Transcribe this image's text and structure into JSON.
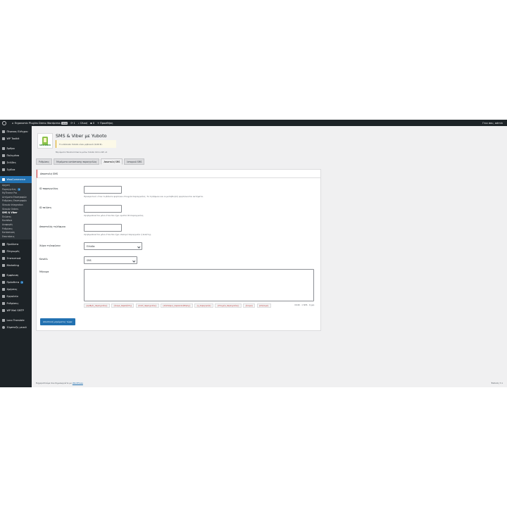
{
  "adminbar": {
    "site_name": "Ergonomic Plugins Demo Wordpress",
    "site_badge": "Live",
    "updates": "1",
    "search": "Ολική",
    "comments": "0",
    "new": "Προσθήκη",
    "user": "Γεια σου, admin"
  },
  "sidebar": {
    "top_items": [
      {
        "label": "Πίνακας Ελέγχου",
        "icon": "dashboard-icon"
      },
      {
        "label": "WP Toolkit",
        "icon": "toolkit-icon"
      }
    ],
    "content_items": [
      {
        "label": "Άρθρα",
        "icon": "pin-icon"
      },
      {
        "label": "Πολυμέσα",
        "icon": "media-icon"
      },
      {
        "label": "Σελίδες",
        "icon": "pages-icon"
      },
      {
        "label": "Σχόλια",
        "icon": "comments-icon"
      }
    ],
    "woocommerce": {
      "label": "WooCommerce",
      "icon": "woocommerce-icon"
    },
    "woo_sub": [
      {
        "label": "Αρχική",
        "current": false
      },
      {
        "label": "Παραγγελίες",
        "count": "1",
        "current": false
      },
      {
        "label": "MyTheme Pro",
        "current": false
      },
      {
        "label": "Αιτήματα Επιστροφών",
        "current": false
      },
      {
        "label": "Ρυθμίσεις Επιστροφών",
        "current": false
      },
      {
        "label": "Skroutz Integration",
        "current": false
      },
      {
        "label": "Skroutz Orders",
        "current": false
      },
      {
        "label": "SMS & Viber",
        "current": true
      },
      {
        "label": "Πελάτες",
        "current": false
      },
      {
        "label": "Κουπόνια",
        "current": false
      },
      {
        "label": "Αναφορές",
        "current": false
      },
      {
        "label": "Ρυθμίσεις",
        "current": false
      },
      {
        "label": "Κατάσταση",
        "current": false
      },
      {
        "label": "Επεκτάσεις",
        "current": false
      }
    ],
    "bottom_group_1": [
      {
        "label": "Προϊόντα",
        "icon": "products-icon"
      },
      {
        "label": "Πληρωμές",
        "icon": "payments-icon"
      },
      {
        "label": "Στατιστικά",
        "icon": "analytics-icon"
      },
      {
        "label": "Marketing",
        "icon": "marketing-icon"
      }
    ],
    "bottom_group_2": [
      {
        "label": "Εμφάνιση",
        "icon": "appearance-icon"
      },
      {
        "label": "Πρόσθετα",
        "icon": "plugins-icon",
        "count": "1"
      },
      {
        "label": "Χρήστες",
        "icon": "users-icon"
      },
      {
        "label": "Εργαλεία",
        "icon": "tools-icon"
      },
      {
        "label": "Ρυθμίσεις",
        "icon": "settings-icon"
      },
      {
        "label": "WP Mail SMTP",
        "icon": "mail-icon"
      }
    ],
    "bottom_group_3": [
      {
        "label": "Loco Translate",
        "icon": "translate-icon"
      },
      {
        "label": "Σύμπτυξη μενού",
        "icon": "collapse-icon"
      }
    ]
  },
  "page": {
    "title": "SMS & Viber με Yuboto",
    "logo_text": "SMS-VIBER",
    "notice": "Το υπόλοιπο Yuboto είναι μηδενικό (0,00 €).",
    "subtitle": "Μηνύματα WooCommerce μέσω Yuboto Omni API v1"
  },
  "tabs": [
    {
      "label": "Ρυθμίσεις",
      "active": false
    },
    {
      "label": "Μηνύματα κατάστασης παραγγελίας",
      "active": false
    },
    {
      "label": "Αποστολή SMS",
      "active": true
    },
    {
      "label": "Ιστορικό SMS",
      "active": false
    }
  ],
  "form": {
    "panel_title": "Αποστολή SMS",
    "order_id_label": "ID παραγγελίας",
    "order_id_help": "Προαιρετικό: όταν το βάλετε φορτώνει στοιχεία παραγγελίας. Το τηλέφωνο και οι μεταβλητές φορτώνονται αυτόματα.",
    "client_id_label": "ID πελάτη",
    "client_id_help": "Χρησιμοποιείται μόνο όταν δεν έχει οριστεί ID παραγγελίας.",
    "phone_label": "Αποστολής τηλέφωνο",
    "phone_help": "Χρησιμοποιείται μόνο όταν δεν έχει επιλεγεί παραγγελία ή πελάτης.",
    "country_label": "Χώρα τηλεφώνου",
    "country_value": "Ελλάδα",
    "channel_label": "Κανάλι",
    "channel_value": "SMS",
    "message_label": "Μήνυμα",
    "chips": [
      "{αριθμός_παραγγελίας}",
      "{όνομα_παραλήπτη}",
      "{ποσό_παραγγελίας}",
      "{σύνδεσμος_παρακολούθησης}",
      "{η_παραγγελία}",
      "{στοιχεία_παραγγελίας}",
      "{όνομα}",
      "{επώνυμο}"
    ],
    "counter": "0/160 · 1 SMS · 0 χαρ.",
    "send_button": "Αποστολή μηνύματος τώρα"
  },
  "footer": {
    "left_text": "Ευχαριστούμε που δημιουργείτε με ",
    "left_link": "WordPress",
    "version": "Έκδοση 7.1"
  },
  "colors": {
    "admin_dark": "#1d2327",
    "accent": "#2271b1",
    "background": "#f0f0f1",
    "notice_border": "#dba617"
  }
}
